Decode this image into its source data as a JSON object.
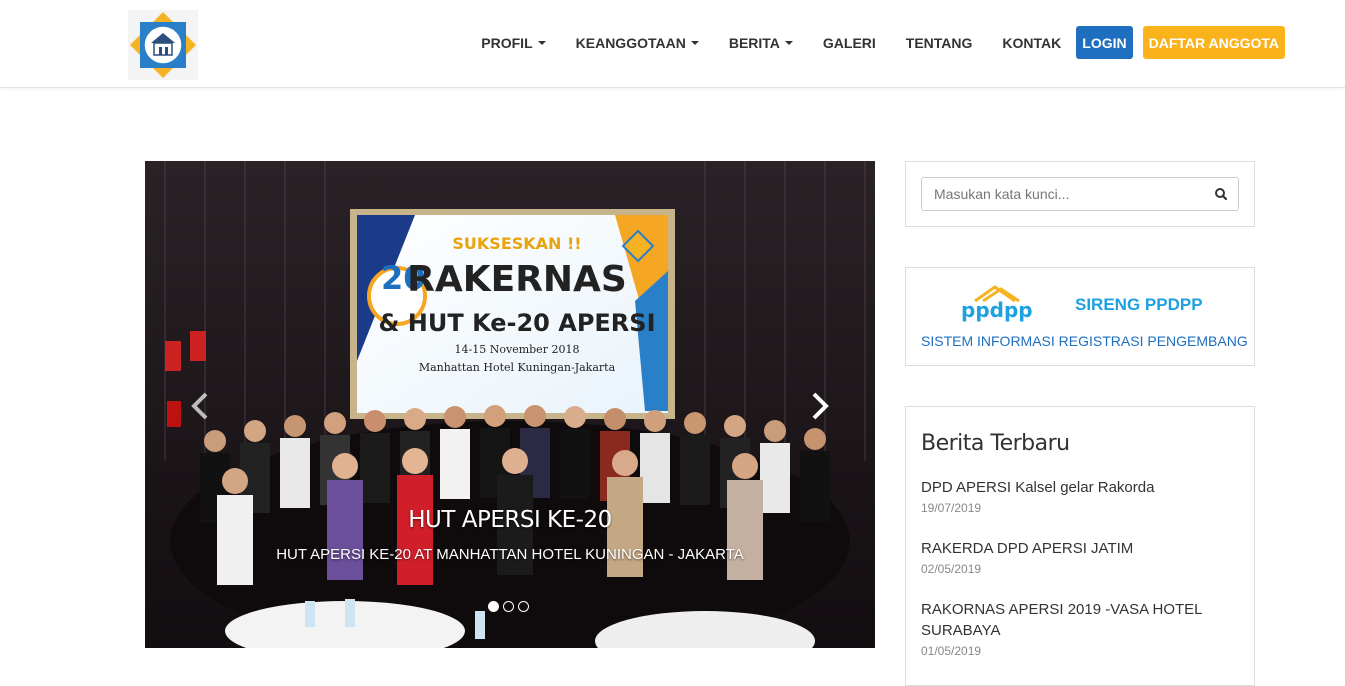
{
  "nav": {
    "items": [
      {
        "label": "PROFIL",
        "dropdown": true
      },
      {
        "label": "KEANGGOTAAN",
        "dropdown": true
      },
      {
        "label": "BERITA",
        "dropdown": true
      },
      {
        "label": "GALERI",
        "dropdown": false
      },
      {
        "label": "TENTANG",
        "dropdown": false
      },
      {
        "label": "KONTAK",
        "dropdown": false
      }
    ],
    "login_label": "LOGIN",
    "register_label": "DAFTAR ANGGOTA"
  },
  "carousel": {
    "title": "HUT APERSI KE-20",
    "subtitle": "HUT APERSI KE-20 AT MANHATTAN HOTEL KUNINGAN - JAKARTA",
    "banner": {
      "line1": "SUKSESKAN !!",
      "line2": "RAKERNAS",
      "line3": "& HUT Ke-20 APERSI",
      "line4": "14-15 November 2018",
      "line5": "Manhattan Hotel Kuningan-Jakarta",
      "number": "20",
      "brand": "APERSI"
    },
    "slide_count": 3,
    "active_slide": 1
  },
  "search": {
    "placeholder": "Masukan kata kunci..."
  },
  "sireng": {
    "logo_text": "ppdpp",
    "title": "SIRENG PPDPP",
    "subtitle": "SISTEM INFORMASI REGISTRASI PENGEMBANG"
  },
  "news": {
    "heading": "Berita Terbaru",
    "items": [
      {
        "title": "DPD APERSI Kalsel gelar Rakorda",
        "date": "19/07/2019"
      },
      {
        "title": "RAKERDA DPD APERSI JATIM",
        "date": "02/05/2019"
      },
      {
        "title": "RAKORNAS APERSI 2019 -VASA HOTEL SURABAYA",
        "date": "01/05/2019"
      }
    ]
  },
  "colors": {
    "login": "#1e6fc0",
    "register": "#fbb31c",
    "sireng": "#1da1e0",
    "link": "#1e6fc0"
  }
}
